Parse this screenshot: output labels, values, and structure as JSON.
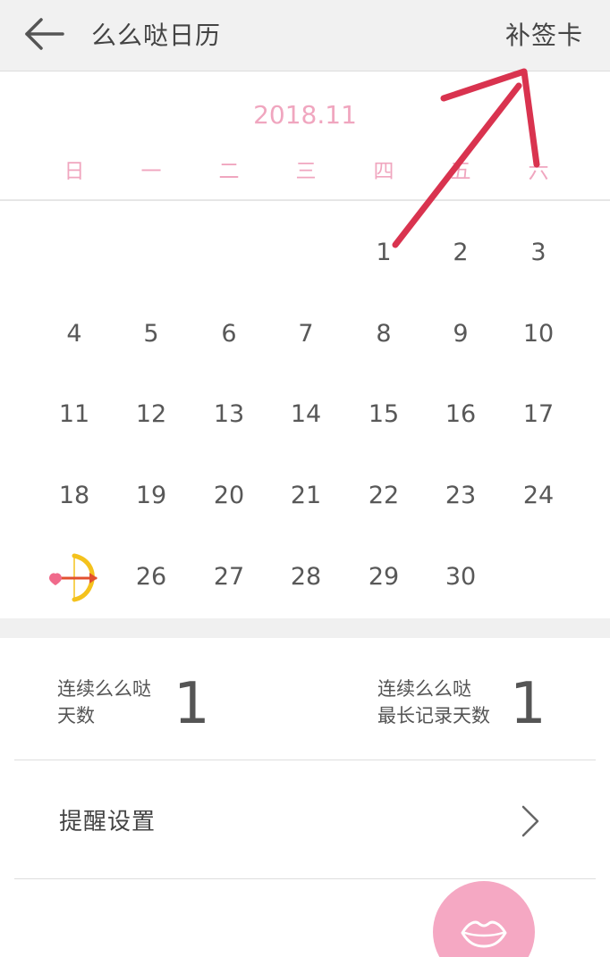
{
  "header": {
    "title": "么么哒日历",
    "action_label": "补签卡"
  },
  "calendar": {
    "month_label": "2018.11",
    "weekdays": [
      "日",
      "一",
      "二",
      "三",
      "四",
      "五",
      "六"
    ],
    "days": [
      "1",
      "2",
      "3",
      "4",
      "5",
      "6",
      "7",
      "8",
      "9",
      "10",
      "11",
      "12",
      "13",
      "14",
      "15",
      "16",
      "17",
      "18",
      "19",
      "20",
      "21",
      "22",
      "23",
      "24",
      "26",
      "27",
      "28",
      "29",
      "30"
    ],
    "special_day_icon": "cupid-bow-heart-icon"
  },
  "stats": {
    "streak_label_line1": "连续么么哒",
    "streak_label_line2": "天数",
    "streak_value": "1",
    "longest_label_line1": "连续么么哒",
    "longest_label_line2": "最长记录天数",
    "longest_value": "1"
  },
  "reminder": {
    "label": "提醒设置"
  },
  "fab": {
    "icon": "lips-icon"
  },
  "colors": {
    "accent_pink": "#f0a6bf",
    "fab_pink": "#f5a8c3",
    "annotation_red": "#d9334f"
  }
}
